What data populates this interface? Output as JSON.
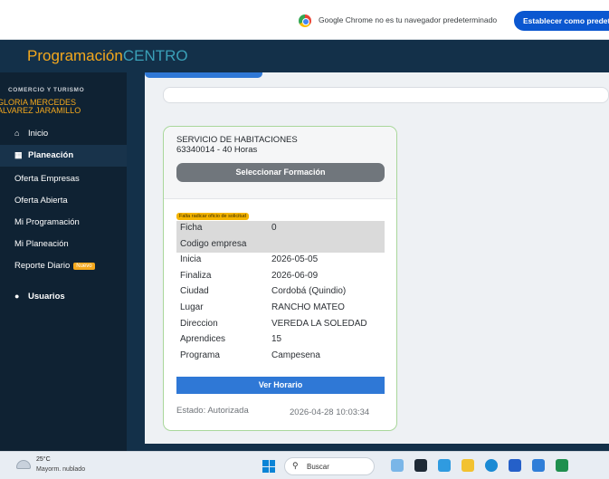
{
  "chrome_bar": {
    "message": "Google Chrome no es tu navegador predeterminado",
    "button_label": "Establecer como predeterminado"
  },
  "header": {
    "brand_part1": "Programación",
    "brand_part2": "CENTRO"
  },
  "sidebar": {
    "department": "COMERCIO Y TURISMO",
    "user_line1": "GLORIA MERCEDES",
    "user_line2": "ALVAREZ JARAMILLO",
    "items": [
      {
        "label": "Inicio",
        "icon": "home-icon"
      },
      {
        "label": "Planeación",
        "icon": "calendar-icon"
      },
      {
        "label": "Oferta Empresas"
      },
      {
        "label": "Oferta Abierta"
      },
      {
        "label": "Mi Programación"
      },
      {
        "label": "Mi Planeación"
      },
      {
        "label": "Reporte Diario",
        "badge": "Nuevo"
      },
      {
        "label": "Usuarios",
        "icon": "user-circle-icon"
      }
    ]
  },
  "card": {
    "title": "SERVICIO DE HABITACIONES",
    "code_hours": "63340014 - 40 Horas",
    "select_button": "Seleccionar Formación",
    "warning_badge": "Falta radicar oficio de solicitud",
    "details": [
      {
        "label": "Ficha",
        "value": "0"
      },
      {
        "label": "Codigo empresa",
        "value": ""
      },
      {
        "label": "Inicia",
        "value": "2026-05-05"
      },
      {
        "label": "Finaliza",
        "value": "2026-06-09"
      },
      {
        "label": "Ciudad",
        "value": "Cordobá (Quindio)"
      },
      {
        "label": "Lugar",
        "value": "RANCHO MATEO"
      },
      {
        "label": "Direccion",
        "value": "VEREDA LA SOLEDAD"
      },
      {
        "label": "Aprendices",
        "value": "15"
      },
      {
        "label": "Programa",
        "value": "Campesena"
      }
    ],
    "horario_button": "Ver Horario",
    "status": "Estado: Autorizada",
    "status_datetime": "2026-04-28 10:03:34"
  },
  "taskbar": {
    "temperature": "25°C",
    "condition": "Mayorm. nublado",
    "search_placeholder": "Buscar"
  },
  "colors": {
    "header_bg": "#133049",
    "sidebar_bg": "#0f2233",
    "accent_orange": "#f4a81d",
    "accent_blue": "#2f78d6",
    "card_border": "#a9d79b"
  }
}
